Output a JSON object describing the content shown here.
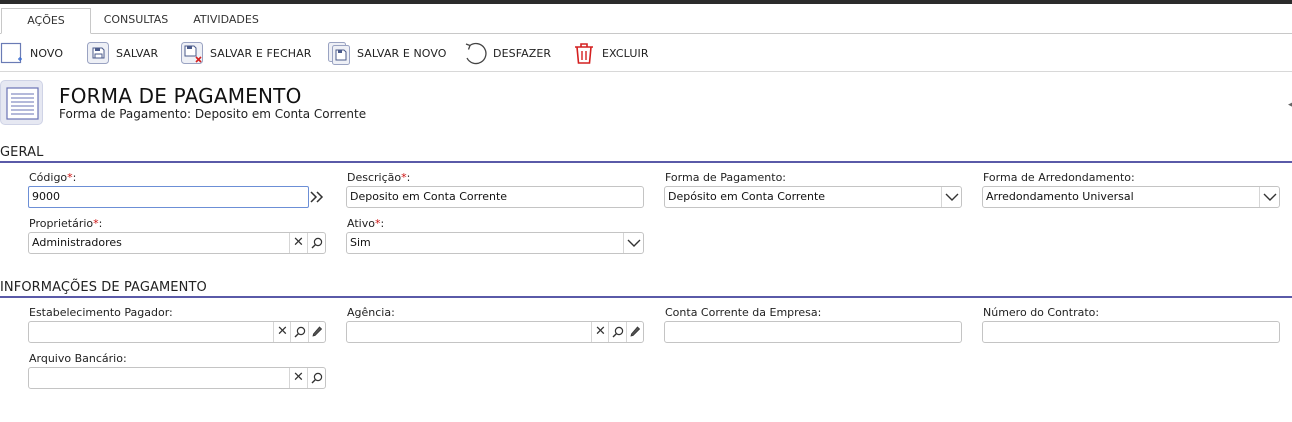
{
  "tabs": [
    {
      "label": "AÇÕES",
      "active": true
    },
    {
      "label": "CONSULTAS",
      "active": false
    },
    {
      "label": "ATIVIDADES",
      "active": false
    }
  ],
  "toolbar": {
    "novo": "NOVO",
    "salvar": "SALVAR",
    "salvar_fechar": "SALVAR E FECHAR",
    "salvar_novo": "SALVAR E NOVO",
    "desfazer": "DESFAZER",
    "excluir": "EXCLUIR"
  },
  "header": {
    "title": "FORMA DE PAGAMENTO",
    "subtitle": "Forma de Pagamento: Deposito em Conta Corrente"
  },
  "geral": {
    "section_title": "GERAL",
    "codigo": {
      "label": "Código",
      "required": "*",
      "suffix": ":",
      "value": "9000"
    },
    "descricao": {
      "label": "Descrição",
      "required": "*",
      "suffix": ":",
      "value": "Deposito em Conta Corrente"
    },
    "forma_pagamento": {
      "label": "Forma de Pagamento:",
      "value": "Depósito em Conta Corrente"
    },
    "forma_arredondamento": {
      "label": "Forma de Arredondamento:",
      "value": "Arredondamento Universal"
    },
    "proprietario": {
      "label": "Proprietário",
      "required": "*",
      "suffix": ":",
      "value": "Administradores"
    },
    "ativo": {
      "label": "Ativo",
      "required": "*",
      "suffix": ":",
      "value": "Sim"
    }
  },
  "pagamento": {
    "section_title": "INFORMAÇÕES DE PAGAMENTO",
    "estabelecimento": {
      "label": "Estabelecimento Pagador:",
      "value": ""
    },
    "agencia": {
      "label": "Agência:",
      "value": ""
    },
    "conta_corrente": {
      "label": "Conta Corrente da Empresa:",
      "value": ""
    },
    "numero_contrato": {
      "label": "Número do Contrato:",
      "value": ""
    },
    "arquivo_bancario": {
      "label": "Arquivo Bancário:",
      "value": ""
    }
  },
  "colors": {
    "accent_line": "#5a5aa8",
    "required": "#cc1111",
    "delete_icon": "#d42020",
    "focus_border": "#6c8fd6"
  },
  "icons": [
    "novo-icon",
    "salvar-icon",
    "salvar-fechar-icon",
    "salvar-novo-icon",
    "desfazer-icon",
    "excluir-icon",
    "document-icon",
    "clear-icon",
    "search-icon",
    "edit-icon",
    "chevron-down-icon",
    "double-chevron-icon"
  ]
}
